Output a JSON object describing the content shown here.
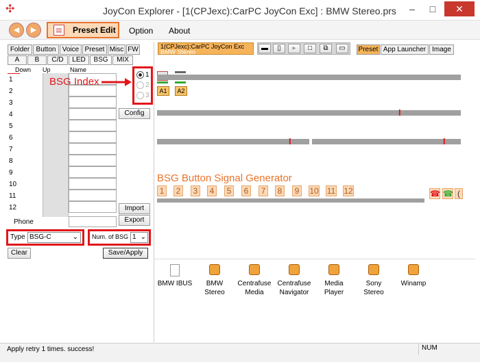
{
  "window": {
    "title": "JoyCon Explorer - [1(CPJexc):CarPC JoyCon Exc] : BMW Stereo.prs",
    "minimize": "–",
    "maximize": "□",
    "close": "✕"
  },
  "toolbar": {
    "preset_edit": "Preset Edit",
    "menu": [
      "Option",
      "About"
    ]
  },
  "left": {
    "tabs_top": [
      "Folder",
      "Button",
      "Voice",
      "Preset",
      "Misc",
      "FW"
    ],
    "tabs_second": [
      "A",
      "B",
      "C/D",
      "LED",
      "BSG",
      "MIX"
    ],
    "grid_headers": {
      "down": "Down",
      "up": "Up",
      "name": "Name"
    },
    "rows": [
      "1",
      "2",
      "3",
      "4",
      "5",
      "6",
      "7",
      "8",
      "9",
      "10",
      "11",
      "12"
    ],
    "phone_label": "Phone",
    "radio_labels": [
      "1",
      "2",
      "3"
    ],
    "config_button": "Config",
    "import_button": "Import",
    "export_button": "Export",
    "type_label": "Type",
    "type_value": "BSG-C",
    "num_bsg_label": "Num. of BSG",
    "num_bsg_value": "1",
    "clear_button": "Clear",
    "save_apply_button": "Save/Apply",
    "annotation": "BSG Index"
  },
  "right": {
    "device_tab_line1": "1(CPJexc):CarPC JoyCon Exc",
    "device_tab_line2": "BMW Stereo",
    "view_tabs": [
      "Preset",
      "App Launcher",
      "Image"
    ],
    "a_buttons": [
      "A1",
      "A2"
    ],
    "bsg_title": "BSG Button Signal Generator",
    "bsg_numbers": [
      "1",
      "2",
      "3",
      "4",
      "5",
      "6",
      "7",
      "8",
      "9",
      "10",
      "11",
      "12"
    ],
    "presets": [
      {
        "line1": "BMW IBUS",
        "line2": ""
      },
      {
        "line1": "BMW",
        "line2": "Stereo"
      },
      {
        "line1": "Centrafuse",
        "line2": "Media"
      },
      {
        "line1": "Centrafuse",
        "line2": "Navigator"
      },
      {
        "line1": "Media",
        "line2": "Player"
      },
      {
        "line1": "Sony",
        "line2": "Stereo"
      },
      {
        "line1": "Winamp",
        "line2": ""
      }
    ]
  },
  "status": {
    "message": "Apply retry  1 times. success!",
    "num": "NUM"
  }
}
